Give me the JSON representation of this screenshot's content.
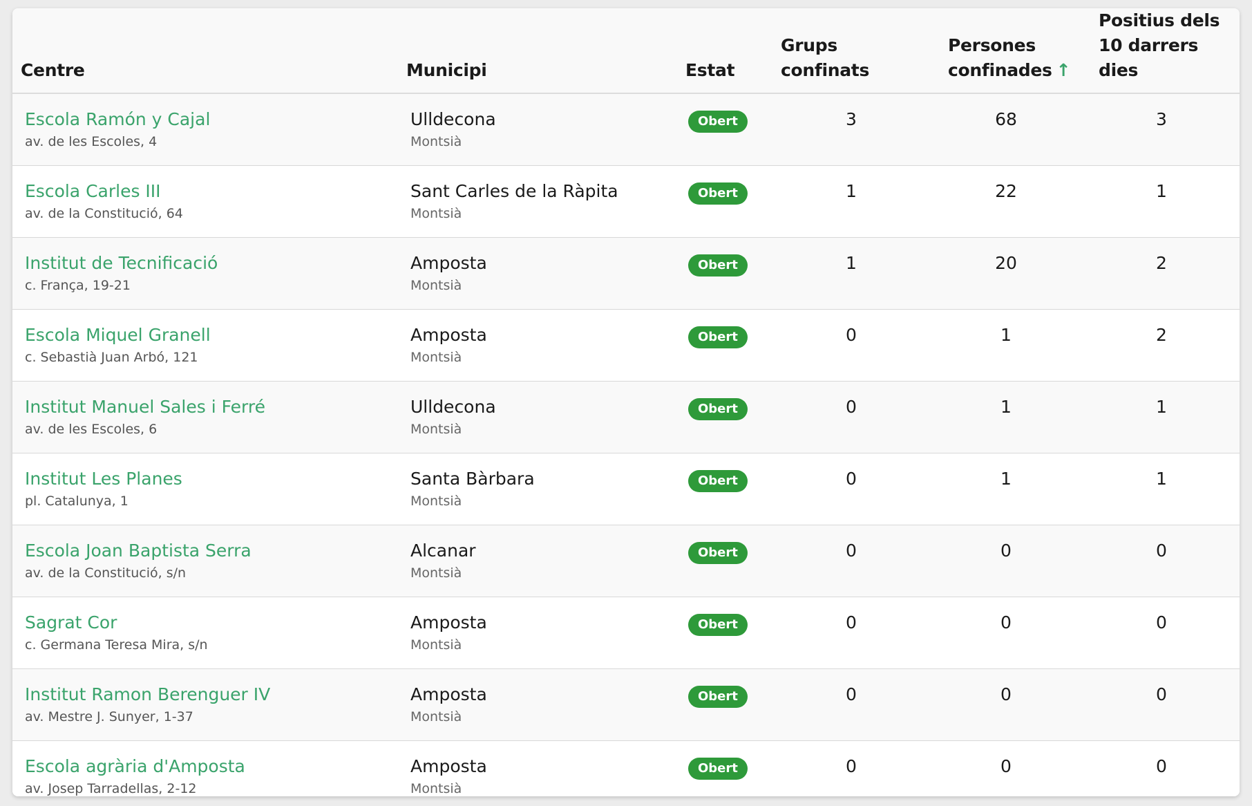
{
  "table": {
    "headers": {
      "centre": "Centre",
      "municipi": "Municipi",
      "estat": "Estat",
      "grups": "Grups confinats",
      "persones": "Persones confinades",
      "positius": "Positius dels 10 darrers dies"
    },
    "sort_icon": "arrow-up-icon",
    "sort_column": "persones",
    "accent_color": "#3aa36b",
    "badge_color": "#2e9a3a",
    "rows": [
      {
        "name": "Escola Ramón y Cajal",
        "address": "av. de les Escoles, 4",
        "town": "Ulldecona",
        "region": "Montsià",
        "status": "Obert",
        "groups": "3",
        "people": "68",
        "positives": "3"
      },
      {
        "name": "Escola Carles III",
        "address": "av. de la Constitució, 64",
        "town": "Sant Carles de la Ràpita",
        "region": "Montsià",
        "status": "Obert",
        "groups": "1",
        "people": "22",
        "positives": "1"
      },
      {
        "name": "Institut de Tecnificació",
        "address": "c. França, 19-21",
        "town": "Amposta",
        "region": "Montsià",
        "status": "Obert",
        "groups": "1",
        "people": "20",
        "positives": "2"
      },
      {
        "name": "Escola Miquel Granell",
        "address": "c. Sebastià Juan Arbó, 121",
        "town": "Amposta",
        "region": "Montsià",
        "status": "Obert",
        "groups": "0",
        "people": "1",
        "positives": "2"
      },
      {
        "name": "Institut Manuel Sales i Ferré",
        "address": "av. de les Escoles, 6",
        "town": "Ulldecona",
        "region": "Montsià",
        "status": "Obert",
        "groups": "0",
        "people": "1",
        "positives": "1"
      },
      {
        "name": "Institut Les Planes",
        "address": "pl. Catalunya, 1",
        "town": "Santa Bàrbara",
        "region": "Montsià",
        "status": "Obert",
        "groups": "0",
        "people": "1",
        "positives": "1"
      },
      {
        "name": "Escola Joan Baptista Serra",
        "address": "av. de la Constitució, s/n",
        "town": "Alcanar",
        "region": "Montsià",
        "status": "Obert",
        "groups": "0",
        "people": "0",
        "positives": "0"
      },
      {
        "name": "Sagrat Cor",
        "address": "c. Germana Teresa Mira, s/n",
        "town": "Amposta",
        "region": "Montsià",
        "status": "Obert",
        "groups": "0",
        "people": "0",
        "positives": "0"
      },
      {
        "name": "Institut Ramon Berenguer IV",
        "address": "av. Mestre J. Sunyer, 1-37",
        "town": "Amposta",
        "region": "Montsià",
        "status": "Obert",
        "groups": "0",
        "people": "0",
        "positives": "0"
      },
      {
        "name": "Escola agrària d'Amposta",
        "address": "av. Josep Tarradellas, 2-12",
        "town": "Amposta",
        "region": "Montsià",
        "status": "Obert",
        "groups": "0",
        "people": "0",
        "positives": "0"
      }
    ]
  }
}
